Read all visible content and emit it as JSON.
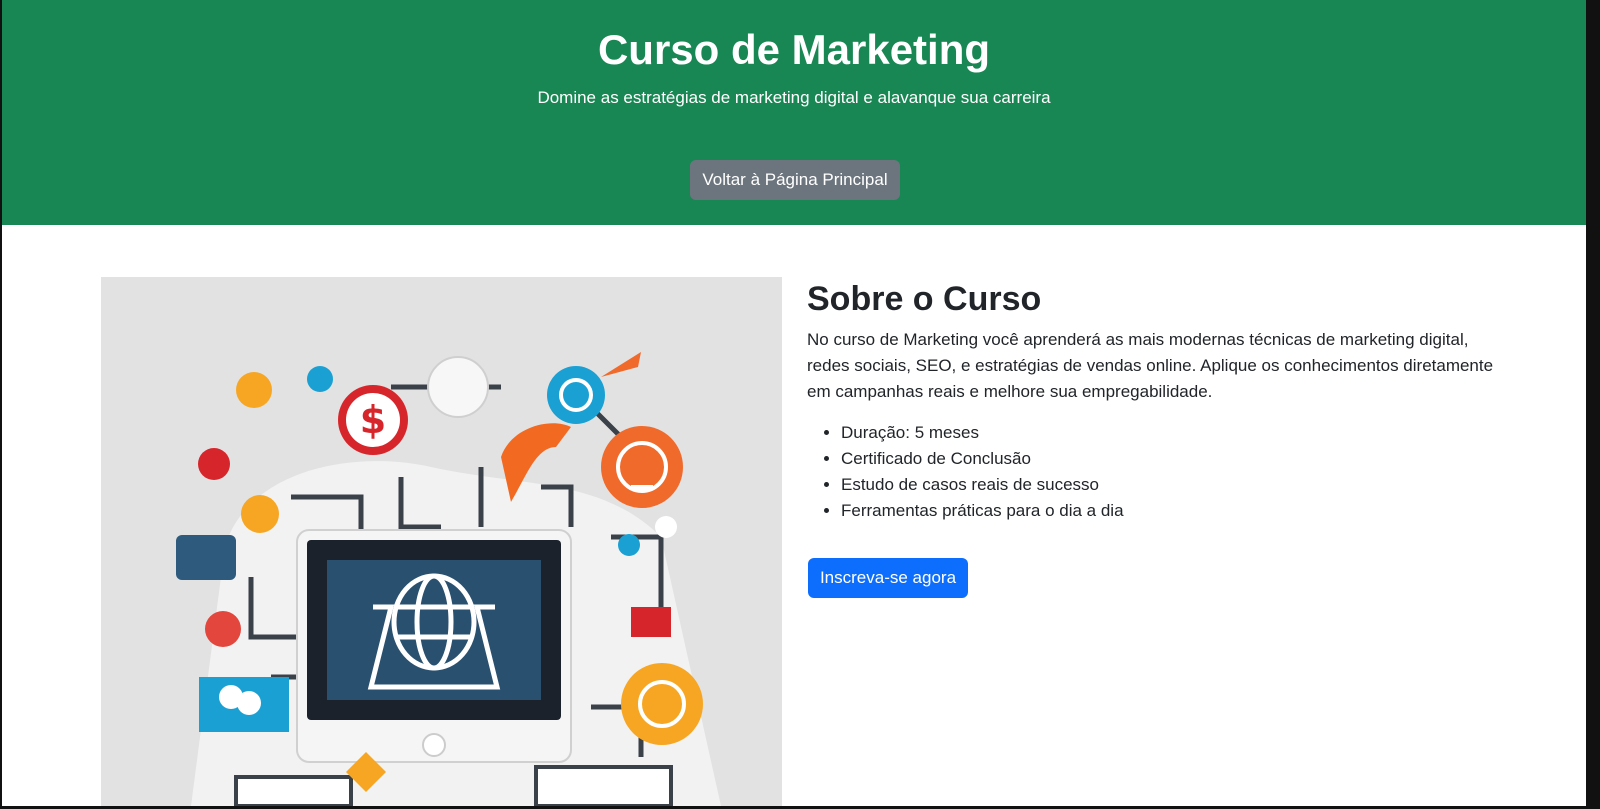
{
  "hero": {
    "title": "Curso de Marketing",
    "subtitle": "Domine as estratégias de marketing digital e alavanque sua carreira",
    "back_button": "Voltar à Página Principal",
    "background_color": "#198754"
  },
  "about": {
    "title": "Sobre o Curso",
    "description": "No curso de Marketing você aprenderá as mais modernas técnicas de marketing digital, redes sociais, SEO, e estratégias de vendas online. Aplique os conhecimentos diretamente em campanhas reais e melhore sua empregabilidade.",
    "features": [
      "Duração: 5 meses",
      "Certificado de Conclusão",
      "Estudo de casos reais de sucesso",
      "Ferramentas práticas para o dia a dia"
    ],
    "enroll_button": "Inscreva-se agora",
    "enroll_color": "#0d6efd"
  },
  "image": {
    "icon": "marketing-illustration"
  }
}
